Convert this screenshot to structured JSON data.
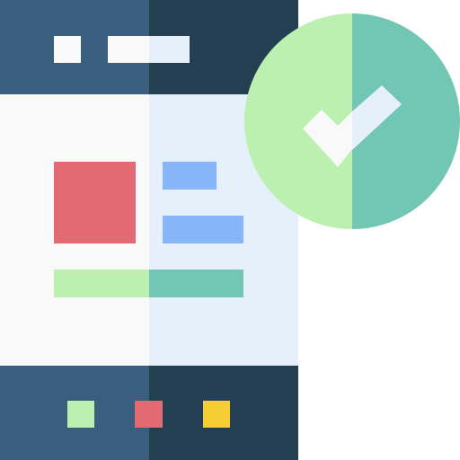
{
  "icon": {
    "subject": "mobile-app-approved-icon",
    "parts": [
      "phone-icon",
      "content-card-icon",
      "check-circle-icon",
      "checkmark-icon"
    ]
  },
  "colors": {
    "phone_header_left": "#3A5F7E",
    "phone_header_right": "#243F52",
    "phone_screen_left": "#F9F9F9",
    "phone_screen_right": "#E6F0FA",
    "image_block": "#E36A73",
    "text_line": "#86B5FA",
    "progress_left": "#BCF0B0",
    "progress_right": "#72C7B4",
    "header_bar_left": "#F9F9F9",
    "header_bar_right": "#E6F0FA",
    "footer_button_green": "#BCF0B0",
    "footer_button_red": "#E36A73",
    "footer_button_yellow": "#F5CD34",
    "check_circle_left": "#BCF0B0",
    "check_circle_right": "#72C7B4",
    "checkmark_left": "#F9F9F9",
    "checkmark_right": "#E6F0FA"
  }
}
